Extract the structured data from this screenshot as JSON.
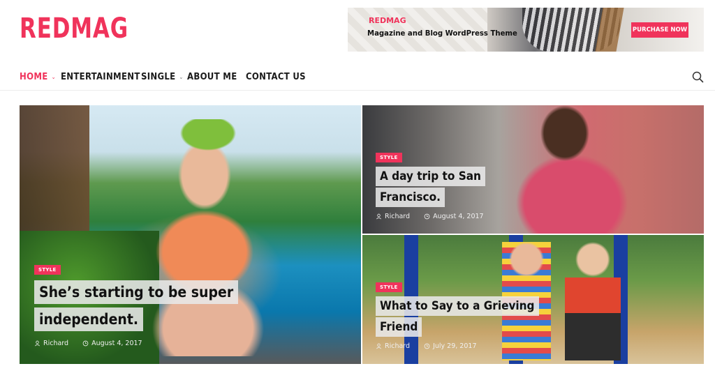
{
  "logo": "REDMAG",
  "banner": {
    "brand": "REDMAG",
    "tagline": "Magazine and Blog WordPress Theme",
    "button": "PURCHASE NOW"
  },
  "nav": {
    "items": [
      {
        "label": "HOME",
        "active": true,
        "dropdown": true
      },
      {
        "label": "ENTERTAINMENT",
        "active": false,
        "dropdown": true
      },
      {
        "label": "SINGLE",
        "active": false,
        "dropdown": true
      },
      {
        "label": "ABOUT ME",
        "active": false,
        "dropdown": false
      },
      {
        "label": "CONTACT US",
        "active": false,
        "dropdown": false
      }
    ],
    "search_icon": "search-icon"
  },
  "posts": [
    {
      "category": "STYLE",
      "title_lines": [
        "She’s starting to be super",
        "independent."
      ],
      "author": "Richard",
      "date": "August 4, 2017"
    },
    {
      "category": "STYLE",
      "title_lines": [
        "A day trip to San",
        "Francisco."
      ],
      "author": "Richard",
      "date": "August 4, 2017"
    },
    {
      "category": "STYLE",
      "title_lines": [
        "What to Say to a Grieving",
        "Friend"
      ],
      "author": "Richard",
      "date": "July 29, 2017"
    }
  ],
  "colors": {
    "accent": "#f0335b"
  }
}
